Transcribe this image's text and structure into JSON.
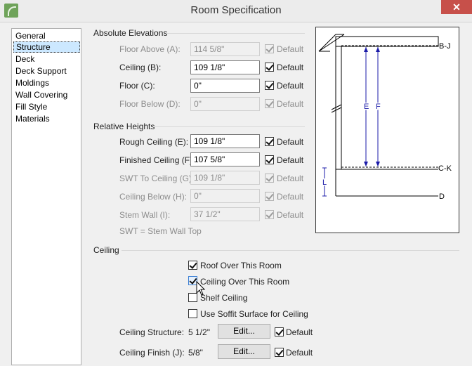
{
  "window": {
    "title": "Room Specification",
    "close": "✕"
  },
  "nav": {
    "items": [
      "General",
      "Structure",
      "Deck",
      "Deck Support",
      "Moldings",
      "Wall Covering",
      "Fill Style",
      "Materials"
    ]
  },
  "absolute": {
    "header": "Absolute Elevations",
    "floor_above": {
      "label": "Floor Above (A):",
      "value": "114 5/8\"",
      "default": "Default"
    },
    "ceiling": {
      "label": "Ceiling (B):",
      "value": "109 1/8\"",
      "default": "Default"
    },
    "floor": {
      "label": "Floor (C):",
      "value": "0\"",
      "default": "Default"
    },
    "floor_below": {
      "label": "Floor Below (D):",
      "value": "0\"",
      "default": "Default"
    }
  },
  "relative": {
    "header": "Relative Heights",
    "rough_ceiling": {
      "label": "Rough Ceiling (E):",
      "value": "109 1/8\"",
      "default": "Default"
    },
    "finished_ceiling": {
      "label": "Finished Ceiling (F):",
      "value": "107 5/8\"",
      "default": "Default"
    },
    "swt_to_ceiling": {
      "label": "SWT To Ceiling (G):",
      "value": "109 1/8\"",
      "default": "Default"
    },
    "ceiling_below": {
      "label": "Ceiling Below (H):",
      "value": "0\"",
      "default": "Default"
    },
    "stem_wall": {
      "label": "Stem Wall (I):",
      "value": "37 1/2\"",
      "default": "Default"
    },
    "note": "SWT = Stem Wall Top"
  },
  "ceiling_section": {
    "header": "Ceiling",
    "roof_over": "Roof Over This Room",
    "ceiling_over": "Ceiling Over This Room",
    "shelf": "Shelf Ceiling",
    "soffit": "Use Soffit Surface for Ceiling",
    "structure": {
      "label": "Ceiling Structure:",
      "value": "5 1/2\"",
      "button": "Edit...",
      "default": "Default"
    },
    "finish": {
      "label": "Ceiling Finish (J):",
      "value": "5/8\"",
      "button": "Edit...",
      "default": "Default"
    }
  },
  "diagram": {
    "labels": {
      "bj": "B-J",
      "e": "E",
      "f": "F",
      "ck": "C-K",
      "l": "L",
      "d": "D"
    }
  }
}
